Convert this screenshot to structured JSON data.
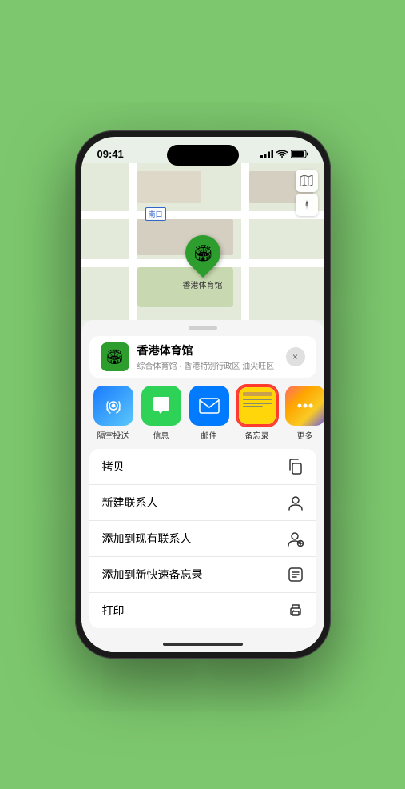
{
  "status_bar": {
    "time": "09:41",
    "signal": "▌▌▌",
    "wifi": "WiFi",
    "battery": "🔋"
  },
  "map": {
    "location_label": "南口",
    "venue_label": "香港体育馆",
    "map_type_icon": "🗺",
    "compass_icon": "➤"
  },
  "venue_header": {
    "name": "香港体育馆",
    "description": "综合体育馆 · 香港特别行政区 油尖旺区",
    "close_label": "×"
  },
  "share_items": [
    {
      "id": "airdrop",
      "label": "隔空投送",
      "icon_type": "airdrop"
    },
    {
      "id": "messages",
      "label": "信息",
      "icon_type": "messages"
    },
    {
      "id": "mail",
      "label": "邮件",
      "icon_type": "mail"
    },
    {
      "id": "notes",
      "label": "备忘录",
      "icon_type": "notes"
    },
    {
      "id": "more",
      "label": "更多",
      "icon_type": "more"
    }
  ],
  "action_items": [
    {
      "id": "copy",
      "label": "拷贝",
      "icon": "⧉"
    },
    {
      "id": "new-contact",
      "label": "新建联系人",
      "icon": "👤"
    },
    {
      "id": "add-existing",
      "label": "添加到现有联系人",
      "icon": "👤"
    },
    {
      "id": "quick-note",
      "label": "添加到新快速备忘录",
      "icon": "⊡"
    },
    {
      "id": "print",
      "label": "打印",
      "icon": "🖨"
    }
  ]
}
